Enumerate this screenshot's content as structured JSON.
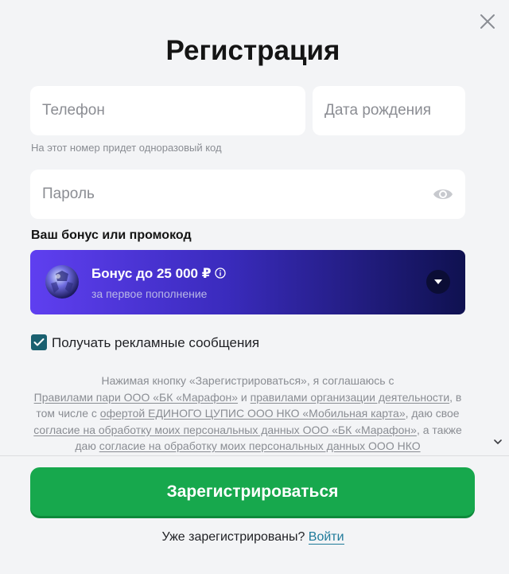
{
  "dialog": {
    "title": "Регистрация",
    "close_icon": "close-icon"
  },
  "form": {
    "phone_placeholder": "Телефон",
    "phone_value": "",
    "dob_placeholder": "Дата рождения",
    "dob_value": "",
    "phone_hint": "На этот номер придет одноразовый код",
    "password_placeholder": "Пароль",
    "password_value": "",
    "password_icon": "eye-icon"
  },
  "bonus": {
    "heading": "Ваш бонус или промокод",
    "title": "Бонус до 25 000 ₽",
    "subtitle": "за первое пополнение",
    "icons": [
      "ball-icon",
      "info-icon",
      "chevron-down-icon"
    ]
  },
  "consent": {
    "checkbox_label": "Получать рекламные сообщения",
    "checked": true
  },
  "legal": {
    "p1": "Нажимая кнопку «Зарегистрироваться», я соглашаюсь с",
    "link1": "Правилами пари ООО «БК «Марафон»",
    "p2": " и ",
    "link2": "правилами организации деятельности",
    "p3": ", в том числе с ",
    "link3": "офертой ЕДИНОГО ЦУПИС ООО НКО «Мобильная карта»",
    "p4": ", даю свое ",
    "link4": "согласие на обработку моих персональных данных ООО «БК «Марафон»",
    "p5": ", а также даю ",
    "link5": "согласие на обработку моих персональных данных ООО НКО"
  },
  "footer": {
    "register_label": "Зарегистрироваться",
    "already_text": "Уже зарегистрированы? ",
    "login_label": "Войти"
  },
  "colors": {
    "primary_green": "#17a84d",
    "link_teal": "#1f7a9a",
    "checkbox": "#1a6070",
    "bonus_gradient_start": "#5f3ff0",
    "bonus_gradient_end": "#0f1150"
  }
}
